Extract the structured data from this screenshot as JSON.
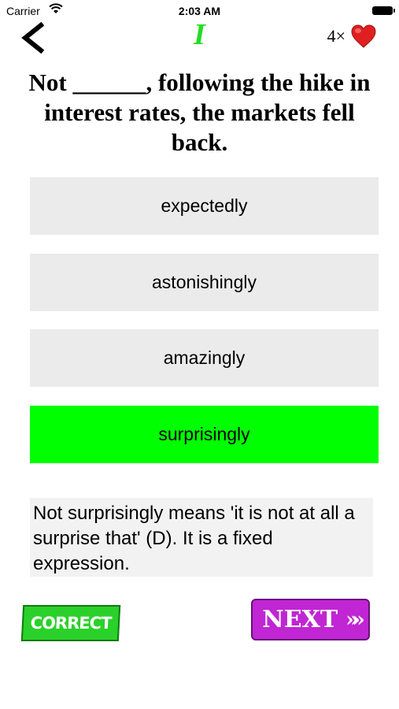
{
  "status_bar": {
    "carrier": "Carrier",
    "time": "2:03 AM"
  },
  "header": {
    "level_label": "I",
    "lives_count": "4×"
  },
  "question": {
    "text": "Not ______, following the hike in interest rates, the markets fell back."
  },
  "options": [
    {
      "label": "expectedly",
      "state": "normal"
    },
    {
      "label": "astonishingly",
      "state": "normal"
    },
    {
      "label": "amazingly",
      "state": "normal"
    },
    {
      "label": "surprisingly",
      "state": "correct"
    }
  ],
  "explanation": {
    "text": "Not surprisingly means 'it is not at all a surprise that' (D). It is a fixed expression."
  },
  "result": {
    "badge_label": "CORRECT"
  },
  "navigation": {
    "next_label": "NEXT",
    "next_arrows": "»»"
  },
  "colors": {
    "correct_option": "#00ff00",
    "next_button": "#c026d3",
    "level_text": "#22dd22",
    "heart": "#e02020"
  },
  "icons": {
    "back": "back-chevron-icon",
    "lives": "heart-icon",
    "wifi": "wifi-icon",
    "battery": "battery-icon"
  }
}
